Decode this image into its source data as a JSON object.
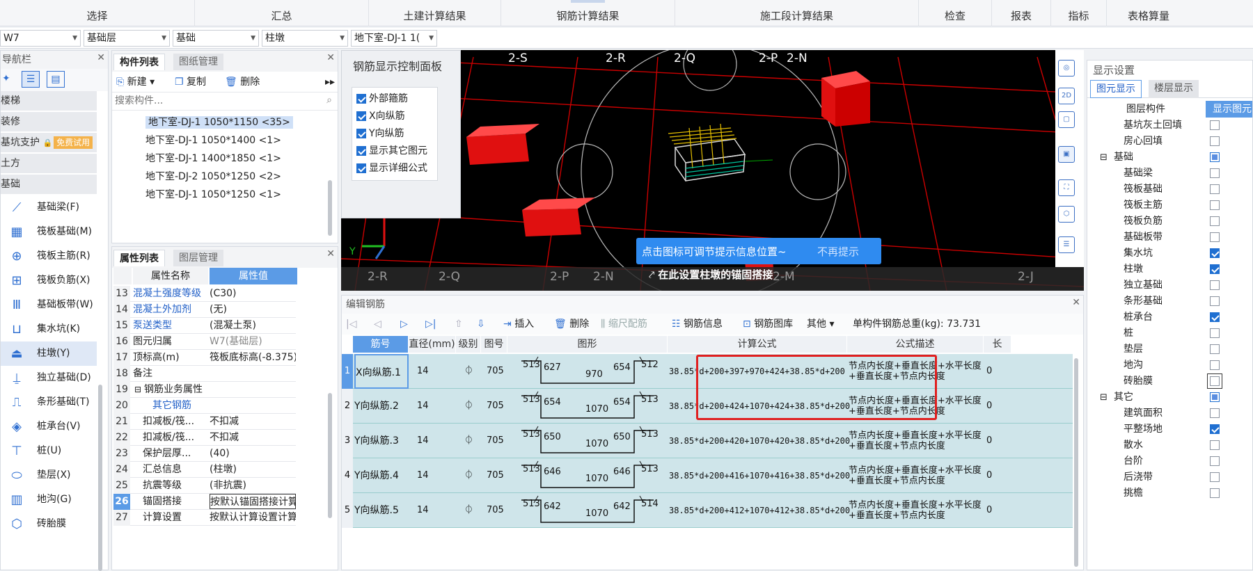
{
  "ribbon": {
    "tabs": [
      "选择",
      "汇总",
      "土建计算结果",
      "钢筋计算结果",
      "施工段计算结果",
      "检查",
      "报表",
      "指标",
      "表格算量"
    ]
  },
  "filters": [
    {
      "value": "W7"
    },
    {
      "value": "基础层"
    },
    {
      "value": "基础"
    },
    {
      "value": "柱墩"
    },
    {
      "value": "地下室-DJ-1 1("
    }
  ],
  "nav": {
    "title": "导航栏",
    "categories": [
      "楼梯",
      "装修",
      "基坑支护",
      "土方",
      "基础"
    ],
    "trial_badge": "免费试用",
    "items": [
      {
        "label": "基础梁(F)",
        "icon": "foundation-beam-icon"
      },
      {
        "label": "筏板基础(M)",
        "icon": "raft-foundation-icon"
      },
      {
        "label": "筏板主筋(R)",
        "icon": "raft-main-rebar-icon"
      },
      {
        "label": "筏板负筋(X)",
        "icon": "raft-negative-rebar-icon"
      },
      {
        "label": "基础板带(W)",
        "icon": "foundation-strip-icon"
      },
      {
        "label": "集水坑(K)",
        "icon": "sump-pit-icon"
      },
      {
        "label": "柱墩(Y)",
        "icon": "column-pier-icon"
      },
      {
        "label": "独立基础(D)",
        "icon": "isolated-footing-icon"
      },
      {
        "label": "条形基础(T)",
        "icon": "strip-footing-icon"
      },
      {
        "label": "桩承台(V)",
        "icon": "pile-cap-icon"
      },
      {
        "label": "桩(U)",
        "icon": "pile-icon"
      },
      {
        "label": "垫层(X)",
        "icon": "cushion-icon"
      },
      {
        "label": "地沟(G)",
        "icon": "trench-icon"
      },
      {
        "label": "砖胎膜",
        "icon": "brick-mold-icon"
      }
    ]
  },
  "component_panel": {
    "tabs": [
      "构件列表",
      "图纸管理"
    ],
    "new_label": "新建",
    "copy_label": "复制",
    "delete_label": "删除",
    "search_placeholder": "搜索构件...",
    "items": [
      "地下室-DJ-1 1050*1150 <35>",
      "地下室-DJ-1 1050*1400 <1>",
      "地下室-DJ-1 1400*1850 <1>",
      "地下室-DJ-2 1050*1250 <2>",
      "地下室-DJ-1 1050*1250 <1>"
    ]
  },
  "property_panel": {
    "tabs": [
      "属性列表",
      "图层管理"
    ],
    "col_name": "属性名称",
    "col_value": "属性值",
    "rows": [
      {
        "n": "13",
        "k": "混凝土强度等级",
        "v": "(C30)",
        "blue": true
      },
      {
        "n": "14",
        "k": "混凝土外加剂",
        "v": "(无)",
        "blue": true
      },
      {
        "n": "15",
        "k": "泵送类型",
        "v": "(混凝土泵)",
        "blue": true
      },
      {
        "n": "16",
        "k": "图元归属",
        "v": "W7(基础层)",
        "blue": false
      },
      {
        "n": "17",
        "k": "顶标高(m)",
        "v": "筏板底标高(-8.375)",
        "blue": false
      },
      {
        "n": "18",
        "k": "备注",
        "v": "",
        "blue": false
      },
      {
        "n": "19",
        "k": "钢筋业务属性",
        "v": "",
        "blue": false
      },
      {
        "n": "20",
        "k": "其它钢筋",
        "v": "",
        "blue": true
      },
      {
        "n": "21",
        "k": "扣减板/筏...",
        "v": "不扣减",
        "blue": false
      },
      {
        "n": "22",
        "k": "扣减板/筏...",
        "v": "不扣减",
        "blue": false
      },
      {
        "n": "23",
        "k": "保护层厚...",
        "v": "(40)",
        "blue": false
      },
      {
        "n": "24",
        "k": "汇总信息",
        "v": "(柱墩)",
        "blue": false
      },
      {
        "n": "25",
        "k": "抗震等级",
        "v": "(非抗震)",
        "blue": false
      },
      {
        "n": "26",
        "k": "锚固搭接",
        "v": "按默认锚固搭接计算",
        "blue": false
      },
      {
        "n": "27",
        "k": "计算设置",
        "v": "按默认计算设置计算",
        "blue": false
      }
    ]
  },
  "viewport": {
    "control_title": "钢筋显示控制面板",
    "checks": [
      "外部箍筋",
      "X向纵筋",
      "Y向纵筋",
      "显示其它图元",
      "显示详细公式"
    ],
    "axis_top": [
      "2-S",
      "2-R",
      "2-Q",
      "2-P",
      "2-N"
    ],
    "axis_bottom": [
      "2-R",
      "2-Q",
      "2-P",
      "2-N",
      "2-M",
      "2-J"
    ],
    "tip_text": "点击图标可调节提示信息位置~",
    "tip_dismiss": "不再提示",
    "hint_text": "在此设置柱墩的锚固搭接",
    "y_label": "Y"
  },
  "rebar_editor": {
    "title": "编辑钢筋",
    "insert_label": "插入",
    "delete_label": "删除",
    "scale_label": "缩尺配筋",
    "info_label": "钢筋信息",
    "lib_label": "钢筋图库",
    "other_label": "其他",
    "total_label": "单构件钢筋总重(kg): 73.731",
    "headers": [
      "筋号",
      "直径(mm)",
      "级别",
      "图号",
      "图形",
      "计算公式",
      "公式描述",
      "长"
    ],
    "rows": [
      {
        "idx": "1",
        "name": "X向纵筋.1",
        "dia": "14",
        "grade": "⏀",
        "fig": "705",
        "a": "513",
        "b": "627",
        "c": "970",
        "d": "654",
        "e": "512",
        "formula": "38.85*d+200+397+970+424+38.85*d+200",
        "desc": "节点内长度+垂直长度+水平长度+垂直长度+节点内长度",
        "tail": "0"
      },
      {
        "idx": "2",
        "name": "Y向纵筋.2",
        "dia": "14",
        "grade": "⏀",
        "fig": "705",
        "a": "513",
        "b": "654",
        "c": "1070",
        "d": "654",
        "e": "513",
        "formula": "38.85*d+200+424+1070+424+38.85*d+200",
        "desc": "节点内长度+垂直长度+水平长度+垂直长度+节点内长度",
        "tail": "0"
      },
      {
        "idx": "3",
        "name": "Y向纵筋.3",
        "dia": "14",
        "grade": "⏀",
        "fig": "705",
        "a": "513",
        "b": "650",
        "c": "1070",
        "d": "650",
        "e": "513",
        "formula": "38.85*d+200+420+1070+420+38.85*d+200",
        "desc": "节点内长度+垂直长度+水平长度+垂直长度+节点内长度",
        "tail": "0"
      },
      {
        "idx": "4",
        "name": "Y向纵筋.4",
        "dia": "14",
        "grade": "⏀",
        "fig": "705",
        "a": "513",
        "b": "646",
        "c": "1070",
        "d": "646",
        "e": "513",
        "formula": "38.85*d+200+416+1070+416+38.85*d+200",
        "desc": "节点内长度+垂直长度+水平长度+垂直长度+节点内长度",
        "tail": "0"
      },
      {
        "idx": "5",
        "name": "Y向纵筋.5",
        "dia": "14",
        "grade": "⏀",
        "fig": "705",
        "a": "513",
        "b": "642",
        "c": "1070",
        "d": "642",
        "e": "514",
        "formula": "38.85*d+200+412+1070+412+38.85*d+200",
        "desc": "节点内长度+垂直长度+水平长度+垂直长度+节点内长度",
        "tail": "0"
      }
    ]
  },
  "display_settings": {
    "title": "显示设置",
    "tabs": [
      "图元显示",
      "楼层显示"
    ],
    "col_layer": "图层构件",
    "col_show": "显示图元",
    "rows": [
      {
        "label": "基坑灰土回填",
        "indent": 2,
        "state": "off",
        "group": false
      },
      {
        "label": "房心回填",
        "indent": 2,
        "state": "off",
        "group": false
      },
      {
        "label": "基础",
        "indent": 1,
        "state": "part",
        "group": true
      },
      {
        "label": "基础梁",
        "indent": 2,
        "state": "off",
        "group": false
      },
      {
        "label": "筏板基础",
        "indent": 2,
        "state": "off",
        "group": false
      },
      {
        "label": "筏板主筋",
        "indent": 2,
        "state": "off",
        "group": false
      },
      {
        "label": "筏板负筋",
        "indent": 2,
        "state": "off",
        "group": false
      },
      {
        "label": "基础板带",
        "indent": 2,
        "state": "off",
        "group": false
      },
      {
        "label": "集水坑",
        "indent": 2,
        "state": "on",
        "group": false
      },
      {
        "label": "柱墩",
        "indent": 2,
        "state": "on",
        "group": false
      },
      {
        "label": "独立基础",
        "indent": 2,
        "state": "off",
        "group": false
      },
      {
        "label": "条形基础",
        "indent": 2,
        "state": "off",
        "group": false
      },
      {
        "label": "桩承台",
        "indent": 2,
        "state": "on",
        "group": false
      },
      {
        "label": "桩",
        "indent": 2,
        "state": "off",
        "group": false
      },
      {
        "label": "垫层",
        "indent": 2,
        "state": "off",
        "group": false
      },
      {
        "label": "地沟",
        "indent": 2,
        "state": "off",
        "group": false
      },
      {
        "label": "砖胎膜",
        "indent": 2,
        "state": "off",
        "group": false
      },
      {
        "label": "其它",
        "indent": 1,
        "state": "part",
        "group": true
      },
      {
        "label": "建筑面积",
        "indent": 2,
        "state": "off",
        "group": false
      },
      {
        "label": "平整场地",
        "indent": 2,
        "state": "on",
        "group": false
      },
      {
        "label": "散水",
        "indent": 2,
        "state": "off",
        "group": false
      },
      {
        "label": "台阶",
        "indent": 2,
        "state": "off",
        "group": false
      },
      {
        "label": "后浇带",
        "indent": 2,
        "state": "off",
        "group": false
      },
      {
        "label": "挑檐",
        "indent": 2,
        "state": "off",
        "group": false
      }
    ]
  }
}
